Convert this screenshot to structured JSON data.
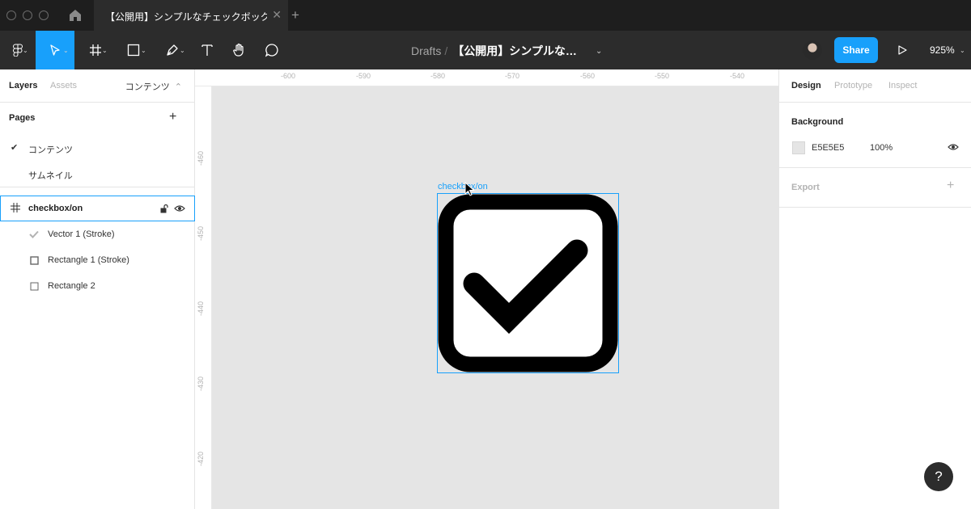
{
  "tab": {
    "title": "【公開用】シンプルなチェックボック…",
    "close": "✕",
    "new": "+"
  },
  "toolbar": {
    "breadcrumb_root": "Drafts",
    "breadcrumb_sep": "/",
    "file_name": "【公開用】シンプルな…",
    "share_label": "Share",
    "zoom": "925%",
    "caret": "⌄"
  },
  "left_panel": {
    "tabs": [
      "Layers",
      "Assets"
    ],
    "current_page": "コンテンツ",
    "page_caret": "⌃",
    "pages_title": "Pages",
    "pages_add": "+",
    "pages": [
      {
        "label": "コンテンツ",
        "check": "✔"
      },
      {
        "label": "サムネイル"
      }
    ],
    "layers": [
      {
        "name": "checkbox/on",
        "icon": "frame-icon"
      },
      {
        "name": "Vector 1 (Stroke)",
        "icon": "check-icon"
      },
      {
        "name": "Rectangle 1 (Stroke)",
        "icon": "square-icon"
      },
      {
        "name": "Rectangle 2",
        "icon": "square-icon"
      }
    ]
  },
  "rulers": {
    "top": [
      "-600",
      "-590",
      "-580",
      "-570",
      "-560",
      "-550",
      "-540"
    ],
    "left": [
      "-460",
      "-450",
      "-440",
      "-430",
      "-420"
    ]
  },
  "canvas": {
    "frame_label": "checkbox/on"
  },
  "right_panel": {
    "tabs": [
      "Design",
      "Prototype",
      "Inspect"
    ],
    "background_title": "Background",
    "background_hex": "E5E5E5",
    "background_opacity": "100%",
    "export_title": "Export",
    "export_add": "+"
  },
  "help_label": "?",
  "colors": {
    "accent": "#18a0fb",
    "toolbar": "#2c2c2c",
    "canvas": "#e5e5e5"
  }
}
